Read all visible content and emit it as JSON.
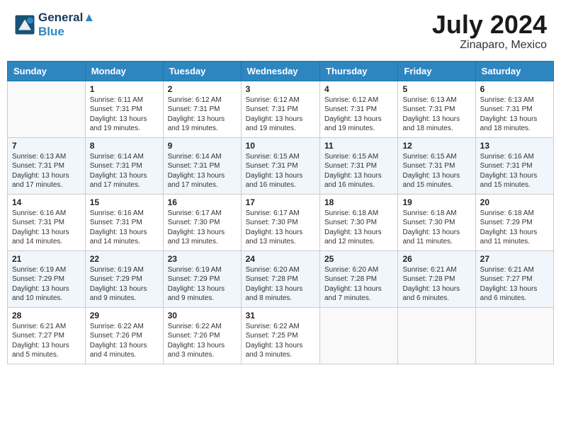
{
  "header": {
    "logo_line1": "General",
    "logo_line2": "Blue",
    "month_year": "July 2024",
    "location": "Zinaparo, Mexico"
  },
  "days_of_week": [
    "Sunday",
    "Monday",
    "Tuesday",
    "Wednesday",
    "Thursday",
    "Friday",
    "Saturday"
  ],
  "weeks": [
    [
      {
        "day": "",
        "empty": true
      },
      {
        "day": "1",
        "sunrise": "6:11 AM",
        "sunset": "7:31 PM",
        "daylight": "13 hours and 19 minutes."
      },
      {
        "day": "2",
        "sunrise": "6:12 AM",
        "sunset": "7:31 PM",
        "daylight": "13 hours and 19 minutes."
      },
      {
        "day": "3",
        "sunrise": "6:12 AM",
        "sunset": "7:31 PM",
        "daylight": "13 hours and 19 minutes."
      },
      {
        "day": "4",
        "sunrise": "6:12 AM",
        "sunset": "7:31 PM",
        "daylight": "13 hours and 19 minutes."
      },
      {
        "day": "5",
        "sunrise": "6:13 AM",
        "sunset": "7:31 PM",
        "daylight": "13 hours and 18 minutes."
      },
      {
        "day": "6",
        "sunrise": "6:13 AM",
        "sunset": "7:31 PM",
        "daylight": "13 hours and 18 minutes."
      }
    ],
    [
      {
        "day": "7",
        "sunrise": "6:13 AM",
        "sunset": "7:31 PM",
        "daylight": "13 hours and 17 minutes."
      },
      {
        "day": "8",
        "sunrise": "6:14 AM",
        "sunset": "7:31 PM",
        "daylight": "13 hours and 17 minutes."
      },
      {
        "day": "9",
        "sunrise": "6:14 AM",
        "sunset": "7:31 PM",
        "daylight": "13 hours and 17 minutes."
      },
      {
        "day": "10",
        "sunrise": "6:15 AM",
        "sunset": "7:31 PM",
        "daylight": "13 hours and 16 minutes."
      },
      {
        "day": "11",
        "sunrise": "6:15 AM",
        "sunset": "7:31 PM",
        "daylight": "13 hours and 16 minutes."
      },
      {
        "day": "12",
        "sunrise": "6:15 AM",
        "sunset": "7:31 PM",
        "daylight": "13 hours and 15 minutes."
      },
      {
        "day": "13",
        "sunrise": "6:16 AM",
        "sunset": "7:31 PM",
        "daylight": "13 hours and 15 minutes."
      }
    ],
    [
      {
        "day": "14",
        "sunrise": "6:16 AM",
        "sunset": "7:31 PM",
        "daylight": "13 hours and 14 minutes."
      },
      {
        "day": "15",
        "sunrise": "6:16 AM",
        "sunset": "7:31 PM",
        "daylight": "13 hours and 14 minutes."
      },
      {
        "day": "16",
        "sunrise": "6:17 AM",
        "sunset": "7:30 PM",
        "daylight": "13 hours and 13 minutes."
      },
      {
        "day": "17",
        "sunrise": "6:17 AM",
        "sunset": "7:30 PM",
        "daylight": "13 hours and 13 minutes."
      },
      {
        "day": "18",
        "sunrise": "6:18 AM",
        "sunset": "7:30 PM",
        "daylight": "13 hours and 12 minutes."
      },
      {
        "day": "19",
        "sunrise": "6:18 AM",
        "sunset": "7:30 PM",
        "daylight": "13 hours and 11 minutes."
      },
      {
        "day": "20",
        "sunrise": "6:18 AM",
        "sunset": "7:29 PM",
        "daylight": "13 hours and 11 minutes."
      }
    ],
    [
      {
        "day": "21",
        "sunrise": "6:19 AM",
        "sunset": "7:29 PM",
        "daylight": "13 hours and 10 minutes."
      },
      {
        "day": "22",
        "sunrise": "6:19 AM",
        "sunset": "7:29 PM",
        "daylight": "13 hours and 9 minutes."
      },
      {
        "day": "23",
        "sunrise": "6:19 AM",
        "sunset": "7:29 PM",
        "daylight": "13 hours and 9 minutes."
      },
      {
        "day": "24",
        "sunrise": "6:20 AM",
        "sunset": "7:28 PM",
        "daylight": "13 hours and 8 minutes."
      },
      {
        "day": "25",
        "sunrise": "6:20 AM",
        "sunset": "7:28 PM",
        "daylight": "13 hours and 7 minutes."
      },
      {
        "day": "26",
        "sunrise": "6:21 AM",
        "sunset": "7:28 PM",
        "daylight": "13 hours and 6 minutes."
      },
      {
        "day": "27",
        "sunrise": "6:21 AM",
        "sunset": "7:27 PM",
        "daylight": "13 hours and 6 minutes."
      }
    ],
    [
      {
        "day": "28",
        "sunrise": "6:21 AM",
        "sunset": "7:27 PM",
        "daylight": "13 hours and 5 minutes."
      },
      {
        "day": "29",
        "sunrise": "6:22 AM",
        "sunset": "7:26 PM",
        "daylight": "13 hours and 4 minutes."
      },
      {
        "day": "30",
        "sunrise": "6:22 AM",
        "sunset": "7:26 PM",
        "daylight": "13 hours and 3 minutes."
      },
      {
        "day": "31",
        "sunrise": "6:22 AM",
        "sunset": "7:25 PM",
        "daylight": "13 hours and 3 minutes."
      },
      {
        "day": "",
        "empty": true
      },
      {
        "day": "",
        "empty": true
      },
      {
        "day": "",
        "empty": true
      }
    ]
  ]
}
